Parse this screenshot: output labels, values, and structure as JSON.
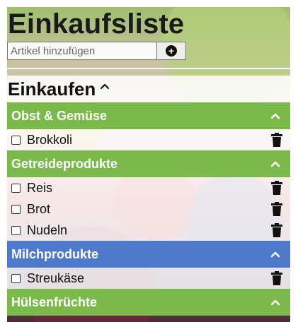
{
  "app": {
    "title": "Einkaufsliste",
    "add_item": {
      "placeholder": "Artikel hinzufügen",
      "value": ""
    }
  },
  "list": {
    "section_title": "Einkaufen",
    "categories": [
      {
        "name": "Obst & Gemüse",
        "color": "#7bb94a",
        "items": [
          "Brokkoli"
        ]
      },
      {
        "name": "Getreideprodukte",
        "color": "#7bb94a",
        "items": [
          "Reis",
          "Brot",
          "Nudeln"
        ]
      },
      {
        "name": "Milchprodukte",
        "color": "#4c79c9",
        "items": [
          "Streukäse"
        ]
      },
      {
        "name": "Hülsenfrüchte",
        "color": "#7bb94a",
        "items": []
      }
    ]
  },
  "icons": {
    "add": "plus-circle-icon",
    "collapse": "chevron-up-icon",
    "delete": "trash-icon",
    "checkbox": "checkbox-icon"
  }
}
